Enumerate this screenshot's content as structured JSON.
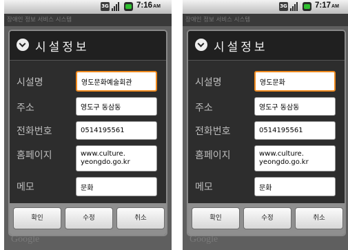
{
  "screens": [
    {
      "status": {
        "network": "3G",
        "time": "7:16",
        "ampm": "AM"
      },
      "app_title": "장애인 정보 서비스 시스템",
      "map_logo": "Google",
      "dialog": {
        "title": "시설정보",
        "fields": [
          {
            "label": "시설명",
            "value": "영도문화예술회관"
          },
          {
            "label": "주소",
            "value": "영도구 동삼동"
          },
          {
            "label": "전화번호",
            "value": "0514195561"
          },
          {
            "label": "홈페이지",
            "value": "www.culture.\nyeongdo.go.kr"
          },
          {
            "label": "메모",
            "value": "문화"
          }
        ],
        "buttons": {
          "ok": "확인",
          "edit": "수정",
          "cancel": "취소"
        }
      }
    },
    {
      "status": {
        "network": "3G",
        "time": "7:17",
        "ampm": "AM"
      },
      "app_title": "장애인 정보 서비스 시스템",
      "map_logo": "Google",
      "dialog": {
        "title": "시설정보",
        "fields": [
          {
            "label": "시설명",
            "value": "영도문화"
          },
          {
            "label": "주소",
            "value": "영도구 동삼동"
          },
          {
            "label": "전화번호",
            "value": "0514195561"
          },
          {
            "label": "홈페이지",
            "value": "www.culture.\nyeongdo.go.kr"
          },
          {
            "label": "메모",
            "value": "문화"
          }
        ],
        "buttons": {
          "ok": "확인",
          "edit": "수정",
          "cancel": "취소"
        }
      }
    }
  ],
  "colors": {
    "focus_border": "#f08a1e",
    "dialog_background": "#2d2d2d",
    "button_bar": "#8f8f8f"
  }
}
